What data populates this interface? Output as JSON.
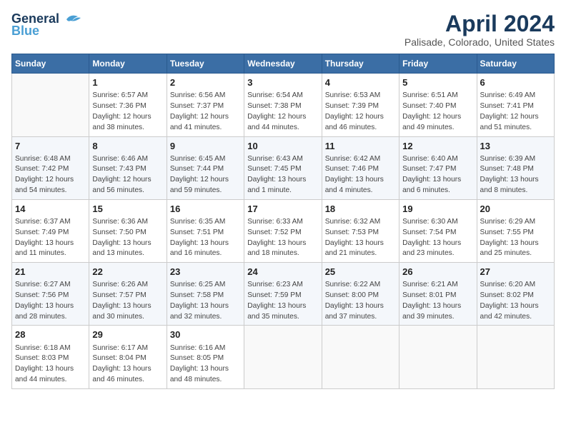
{
  "logo": {
    "line1": "General",
    "line2": "Blue"
  },
  "title": "April 2024",
  "subtitle": "Palisade, Colorado, United States",
  "days_of_week": [
    "Sunday",
    "Monday",
    "Tuesday",
    "Wednesday",
    "Thursday",
    "Friday",
    "Saturday"
  ],
  "weeks": [
    [
      {
        "day": "",
        "info": ""
      },
      {
        "day": "1",
        "info": "Sunrise: 6:57 AM\nSunset: 7:36 PM\nDaylight: 12 hours\nand 38 minutes."
      },
      {
        "day": "2",
        "info": "Sunrise: 6:56 AM\nSunset: 7:37 PM\nDaylight: 12 hours\nand 41 minutes."
      },
      {
        "day": "3",
        "info": "Sunrise: 6:54 AM\nSunset: 7:38 PM\nDaylight: 12 hours\nand 44 minutes."
      },
      {
        "day": "4",
        "info": "Sunrise: 6:53 AM\nSunset: 7:39 PM\nDaylight: 12 hours\nand 46 minutes."
      },
      {
        "day": "5",
        "info": "Sunrise: 6:51 AM\nSunset: 7:40 PM\nDaylight: 12 hours\nand 49 minutes."
      },
      {
        "day": "6",
        "info": "Sunrise: 6:49 AM\nSunset: 7:41 PM\nDaylight: 12 hours\nand 51 minutes."
      }
    ],
    [
      {
        "day": "7",
        "info": "Sunrise: 6:48 AM\nSunset: 7:42 PM\nDaylight: 12 hours\nand 54 minutes."
      },
      {
        "day": "8",
        "info": "Sunrise: 6:46 AM\nSunset: 7:43 PM\nDaylight: 12 hours\nand 56 minutes."
      },
      {
        "day": "9",
        "info": "Sunrise: 6:45 AM\nSunset: 7:44 PM\nDaylight: 12 hours\nand 59 minutes."
      },
      {
        "day": "10",
        "info": "Sunrise: 6:43 AM\nSunset: 7:45 PM\nDaylight: 13 hours\nand 1 minute."
      },
      {
        "day": "11",
        "info": "Sunrise: 6:42 AM\nSunset: 7:46 PM\nDaylight: 13 hours\nand 4 minutes."
      },
      {
        "day": "12",
        "info": "Sunrise: 6:40 AM\nSunset: 7:47 PM\nDaylight: 13 hours\nand 6 minutes."
      },
      {
        "day": "13",
        "info": "Sunrise: 6:39 AM\nSunset: 7:48 PM\nDaylight: 13 hours\nand 8 minutes."
      }
    ],
    [
      {
        "day": "14",
        "info": "Sunrise: 6:37 AM\nSunset: 7:49 PM\nDaylight: 13 hours\nand 11 minutes."
      },
      {
        "day": "15",
        "info": "Sunrise: 6:36 AM\nSunset: 7:50 PM\nDaylight: 13 hours\nand 13 minutes."
      },
      {
        "day": "16",
        "info": "Sunrise: 6:35 AM\nSunset: 7:51 PM\nDaylight: 13 hours\nand 16 minutes."
      },
      {
        "day": "17",
        "info": "Sunrise: 6:33 AM\nSunset: 7:52 PM\nDaylight: 13 hours\nand 18 minutes."
      },
      {
        "day": "18",
        "info": "Sunrise: 6:32 AM\nSunset: 7:53 PM\nDaylight: 13 hours\nand 21 minutes."
      },
      {
        "day": "19",
        "info": "Sunrise: 6:30 AM\nSunset: 7:54 PM\nDaylight: 13 hours\nand 23 minutes."
      },
      {
        "day": "20",
        "info": "Sunrise: 6:29 AM\nSunset: 7:55 PM\nDaylight: 13 hours\nand 25 minutes."
      }
    ],
    [
      {
        "day": "21",
        "info": "Sunrise: 6:27 AM\nSunset: 7:56 PM\nDaylight: 13 hours\nand 28 minutes."
      },
      {
        "day": "22",
        "info": "Sunrise: 6:26 AM\nSunset: 7:57 PM\nDaylight: 13 hours\nand 30 minutes."
      },
      {
        "day": "23",
        "info": "Sunrise: 6:25 AM\nSunset: 7:58 PM\nDaylight: 13 hours\nand 32 minutes."
      },
      {
        "day": "24",
        "info": "Sunrise: 6:23 AM\nSunset: 7:59 PM\nDaylight: 13 hours\nand 35 minutes."
      },
      {
        "day": "25",
        "info": "Sunrise: 6:22 AM\nSunset: 8:00 PM\nDaylight: 13 hours\nand 37 minutes."
      },
      {
        "day": "26",
        "info": "Sunrise: 6:21 AM\nSunset: 8:01 PM\nDaylight: 13 hours\nand 39 minutes."
      },
      {
        "day": "27",
        "info": "Sunrise: 6:20 AM\nSunset: 8:02 PM\nDaylight: 13 hours\nand 42 minutes."
      }
    ],
    [
      {
        "day": "28",
        "info": "Sunrise: 6:18 AM\nSunset: 8:03 PM\nDaylight: 13 hours\nand 44 minutes."
      },
      {
        "day": "29",
        "info": "Sunrise: 6:17 AM\nSunset: 8:04 PM\nDaylight: 13 hours\nand 46 minutes."
      },
      {
        "day": "30",
        "info": "Sunrise: 6:16 AM\nSunset: 8:05 PM\nDaylight: 13 hours\nand 48 minutes."
      },
      {
        "day": "",
        "info": ""
      },
      {
        "day": "",
        "info": ""
      },
      {
        "day": "",
        "info": ""
      },
      {
        "day": "",
        "info": ""
      }
    ]
  ]
}
